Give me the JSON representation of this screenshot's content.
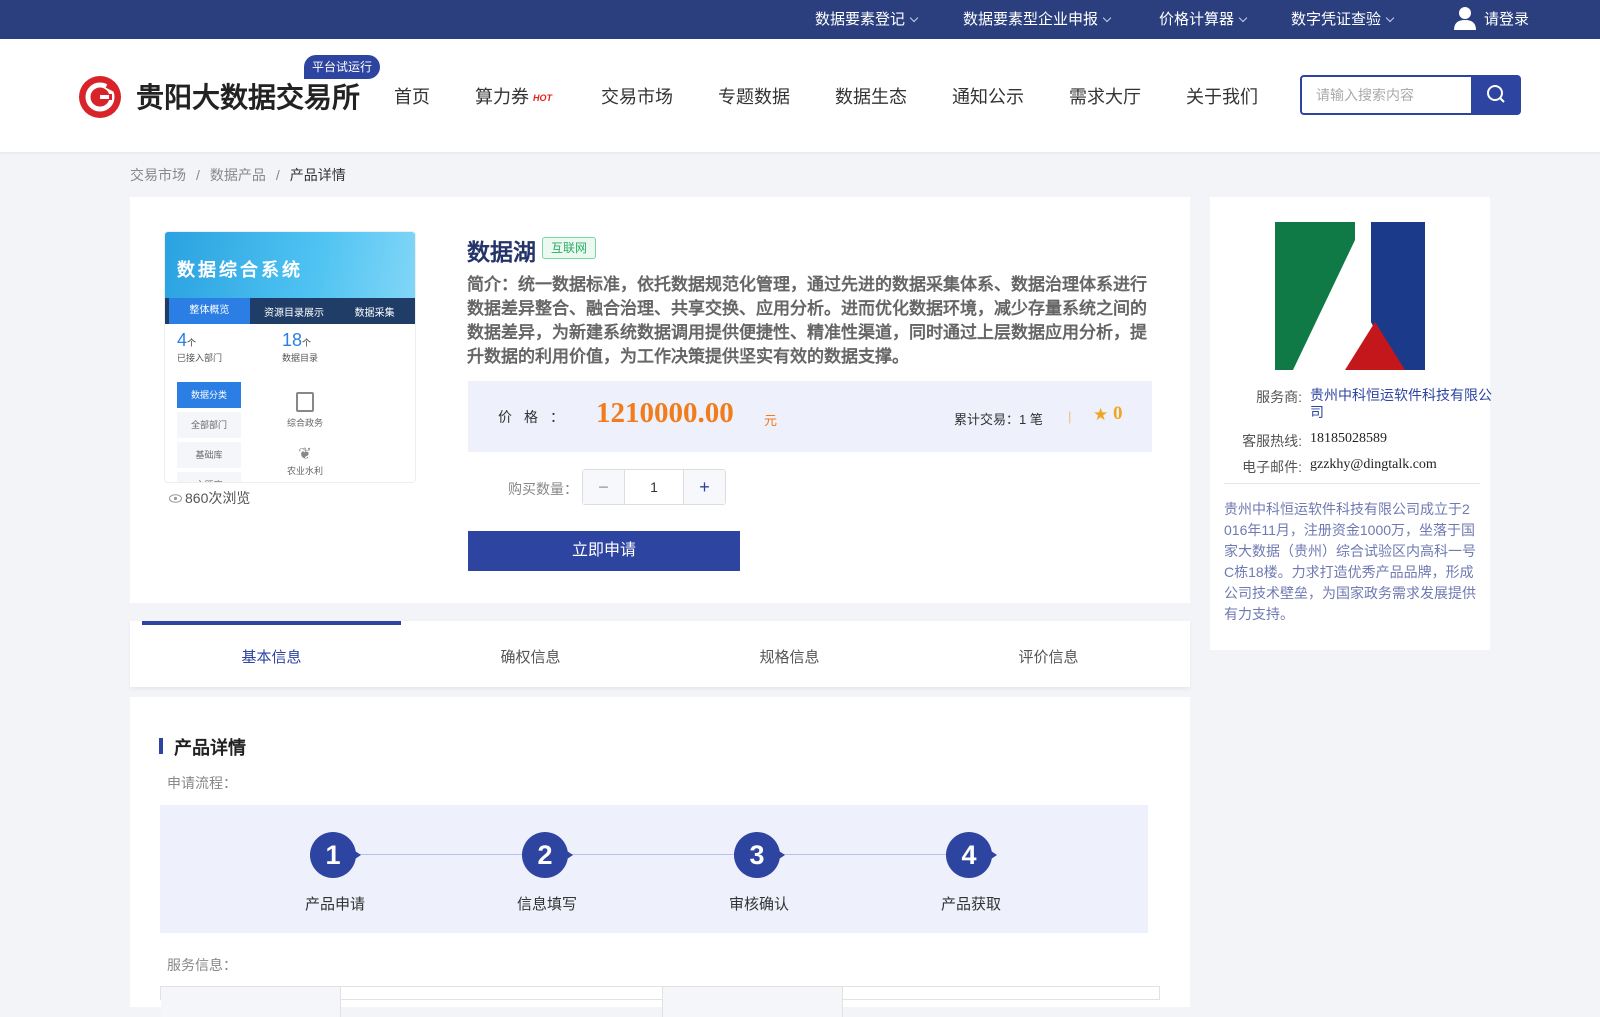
{
  "topbar": {
    "items": [
      "数据要素登记",
      "数据要素型企业申报",
      "价格计算器",
      "数字凭证查验"
    ],
    "login_label": "请登录"
  },
  "header": {
    "logo_text": "贵阳大数据交易所",
    "trial_badge": "平台试运行",
    "nav": [
      "首页",
      "算力券",
      "交易市场",
      "专题数据",
      "数据生态",
      "通知公示",
      "需求大厅",
      "关于我们"
    ],
    "hot_badge": "HOT",
    "search_placeholder": "请输入搜索内容"
  },
  "breadcrumb": [
    "交易市场",
    "数据产品",
    "产品详情"
  ],
  "product": {
    "image": {
      "title": "数据综合系统",
      "tabs": [
        "整体概览",
        "资源目录展示",
        "数据采集"
      ],
      "stat1_value": "4",
      "stat1_unit": "个",
      "stat1_label": "已接入部门",
      "stat2_value": "18",
      "stat2_unit": "个",
      "stat2_label": "数据目录",
      "menu": [
        "数据分类",
        "全部部门",
        "基础库",
        "主题库"
      ],
      "icons": [
        "综合政务",
        "农业水利"
      ]
    },
    "views": "860次浏览",
    "name": "数据湖",
    "tag": "互联网",
    "intro": "简介：统一数据标准，依托数据规范化管理，通过先进的数据采集体系、数据治理体系进行数据差异整合、融合治理、共享交换、应用分析。进而优化数据环境，减少存量系统之间的数据差异，为新建系统数据调用提供便捷性、精准性渠道，同时通过上层数据应用分析，提升数据的利用价值，为工作决策提供坚实有效的数据支撑。",
    "price_label": "价格：",
    "price": "1210000.00",
    "price_unit": "元",
    "trade_label": "累计交易：",
    "trade_count": "1 笔",
    "rating": "0",
    "qty_label": "购买数量：",
    "qty_value": "1",
    "apply_label": "立即申请"
  },
  "vendor": {
    "provider_label": "服务商:",
    "provider": "贵州中科恒运软件科技有限公司",
    "hotline_label": "客服热线:",
    "hotline": "18185028589",
    "email_label": "电子邮件:",
    "email": "gzzkhy@dingtalk.com",
    "description": "贵州中科恒运软件科技有限公司成立于2016年11月，注册资金1000万，坐落于国家大数据（贵州）综合试验区内高科一号C栋18楼。力求打造优秀产品品牌，形成公司技术壁垒，为国家政务需求发展提供有力支持。"
  },
  "tabs": [
    "基本信息",
    "确权信息",
    "规格信息",
    "评价信息"
  ],
  "detail": {
    "title": "产品详情",
    "process_label": "申请流程：",
    "steps": [
      {
        "num": "1",
        "label": "产品申请"
      },
      {
        "num": "2",
        "label": "信息填写"
      },
      {
        "num": "3",
        "label": "审核确认"
      },
      {
        "num": "4",
        "label": "产品获取"
      }
    ],
    "service_label": "服务信息："
  },
  "colors": {
    "primary": "#2d44a0",
    "topbar": "#2b3f7f",
    "price": "#f07c1b",
    "tag": "#2bad65"
  }
}
